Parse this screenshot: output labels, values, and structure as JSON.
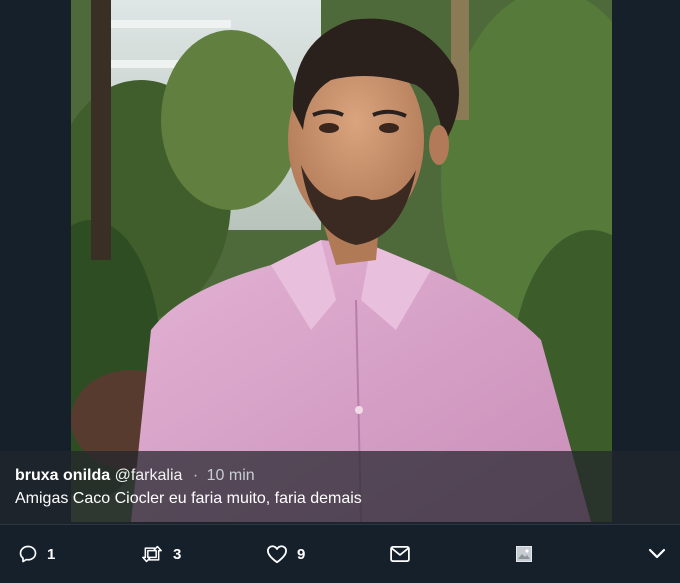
{
  "tweet": {
    "author_name": "bruxa onilda",
    "author_handle": "@farkalia",
    "separator": "·",
    "timestamp": "10 min",
    "text": "Amigas Caco Ciocler eu faria muito, faria demais"
  },
  "actions": {
    "reply_count": "1",
    "retweet_count": "3",
    "like_count": "9"
  },
  "icons": {
    "reply": "reply-icon",
    "retweet": "retweet-icon",
    "like": "heart-icon",
    "message": "envelope-icon",
    "media": "image-icon",
    "more": "chevron-down-icon"
  },
  "colors": {
    "background": "#15202b",
    "shirt": "#d9a3c8",
    "text": "#ffffff"
  }
}
